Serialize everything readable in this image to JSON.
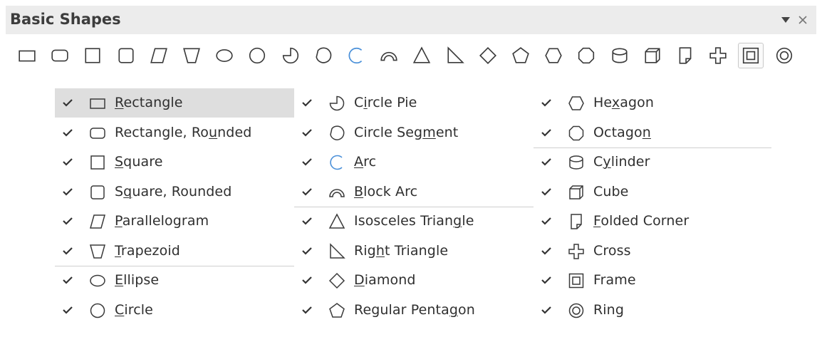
{
  "toolbar": {
    "title": "Basic Shapes",
    "dropdown_icon": "triangle-down-icon",
    "close_icon": "close-icon",
    "shape_icons": [
      "rectangle",
      "rectangle-rounded",
      "square",
      "square-rounded",
      "parallelogram",
      "trapezoid",
      "ellipse",
      "circle",
      "circle-pie",
      "circle-segment",
      "arc",
      "block-arc",
      "isosceles-triangle",
      "right-triangle",
      "diamond",
      "regular-pentagon",
      "hexagon",
      "octagon",
      "cylinder",
      "cube",
      "folded-corner",
      "cross",
      "frame",
      "ring"
    ],
    "selected_icon": "frame"
  },
  "menu": {
    "columns": [
      [
        {
          "pre": "",
          "acc": "R",
          "post": "ectangle",
          "icon": "rectangle",
          "checked": true,
          "highlighted": true
        },
        {
          "pre": "Rectangle, Ro",
          "acc": "u",
          "post": "nded",
          "icon": "rectangle-rounded",
          "checked": true
        },
        {
          "pre": "",
          "acc": "S",
          "post": "quare",
          "icon": "square",
          "checked": true
        },
        {
          "pre": "S",
          "acc": "q",
          "post": "uare, Rounded",
          "icon": "square-rounded",
          "checked": true
        },
        {
          "pre": "",
          "acc": "P",
          "post": "arallelogram",
          "icon": "parallelogram",
          "checked": true
        },
        {
          "pre": "",
          "acc": "T",
          "post": "rapezoid",
          "icon": "trapezoid",
          "checked": true
        },
        {
          "pre": "",
          "acc": "E",
          "post": "llipse",
          "icon": "ellipse",
          "checked": true
        },
        {
          "pre": "",
          "acc": "C",
          "post": "ircle",
          "icon": "circle",
          "checked": true
        }
      ],
      [
        {
          "pre": "C",
          "acc": "i",
          "post": "rcle Pie",
          "icon": "circle-pie",
          "checked": true
        },
        {
          "pre": "Circle Seg",
          "acc": "m",
          "post": "ent",
          "icon": "circle-segment",
          "checked": true
        },
        {
          "pre": "",
          "acc": "A",
          "post": "rc",
          "icon": "arc",
          "checked": true
        },
        {
          "pre": "",
          "acc": "B",
          "post": "lock Arc",
          "icon": "block-arc",
          "checked": true
        },
        {
          "pre": "Isosceles Trian",
          "acc": "g",
          "post": "le",
          "icon": "isosceles-triangle",
          "checked": true
        },
        {
          "pre": "Rig",
          "acc": "h",
          "post": "t Triangle",
          "icon": "right-triangle",
          "checked": true
        },
        {
          "pre": "",
          "acc": "D",
          "post": "iamond",
          "icon": "diamond",
          "checked": true
        },
        {
          "pre": "Regular Penta",
          "acc": "g",
          "post": "on",
          "icon": "regular-pentagon",
          "checked": true
        }
      ],
      [
        {
          "pre": "He",
          "acc": "x",
          "post": "agon",
          "icon": "hexagon",
          "checked": true
        },
        {
          "pre": "Octago",
          "acc": "n",
          "post": "",
          "icon": "octagon",
          "checked": true
        },
        {
          "pre": "C",
          "acc": "y",
          "post": "linder",
          "icon": "cylinder",
          "checked": true
        },
        {
          "pre": "Cube",
          "acc": "",
          "post": "",
          "icon": "cube",
          "checked": true
        },
        {
          "pre": "",
          "acc": "F",
          "post": "olded Corner",
          "icon": "folded-corner",
          "checked": true
        },
        {
          "pre": "Cross",
          "acc": "",
          "post": "",
          "icon": "cross",
          "checked": true
        },
        {
          "pre": "Frame",
          "acc": "",
          "post": "",
          "icon": "frame",
          "checked": true
        },
        {
          "pre": "Ring",
          "acc": "",
          "post": "",
          "icon": "ring",
          "checked": true
        }
      ]
    ]
  },
  "colors": {
    "icon_stroke": "#3a3a3a",
    "arc_blue": "#4a90d9",
    "highlight": "#dedede",
    "titlebar": "#ececec"
  }
}
